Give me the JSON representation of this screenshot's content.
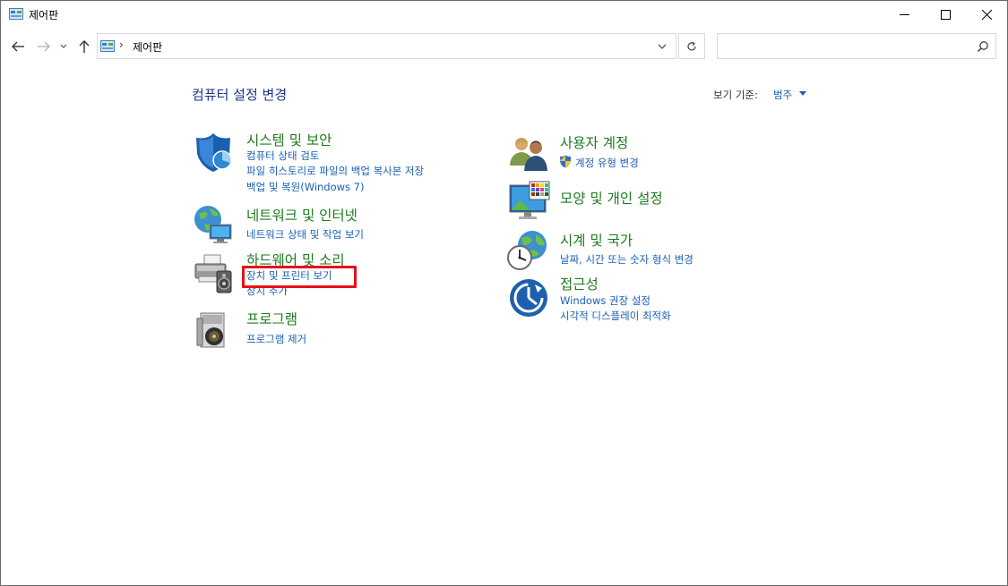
{
  "window": {
    "title": "제어판"
  },
  "nav": {
    "address": "제어판",
    "separator": "›",
    "search_placeholder": ""
  },
  "page": {
    "title": "컴퓨터 설정 변경",
    "view_by_label": "보기 기준:",
    "view_by_value": "범주"
  },
  "left": [
    {
      "title": "시스템 및 보안",
      "links": [
        "컴퓨터 상태 검토",
        "파일 히스토리로 파일의 백업 복사본 저장",
        "백업 및 복원(Windows 7)"
      ]
    },
    {
      "title": "네트워크 및 인터넷",
      "links": [
        "네트워크 상태 및 작업 보기"
      ]
    },
    {
      "title": "하드웨어 및 소리",
      "links": [
        "장치 및 프린터 보기",
        "장치 추가"
      ]
    },
    {
      "title": "프로그램",
      "links": [
        "프로그램 제거"
      ]
    }
  ],
  "right": [
    {
      "title": "사용자 계정",
      "links": [
        "계정 유형 변경"
      ]
    },
    {
      "title": "모양 및 개인 설정",
      "links": []
    },
    {
      "title": "시계 및 국가",
      "links": [
        "날짜, 시간 또는 숫자 형식 변경"
      ]
    },
    {
      "title": "접근성",
      "links": [
        "Windows 권장 설정",
        "시각적 디스플레이 최적화"
      ]
    }
  ],
  "colors": {
    "title_blue": "#1e3287",
    "category_green": "#1e7a1e",
    "link_blue": "#1a5fb4",
    "highlight_red": "#e8101a"
  },
  "icons": {
    "title": "control-panel-icon",
    "back": "arrow-left-icon",
    "forward": "arrow-right-icon",
    "recent": "chevron-down-icon",
    "up": "arrow-up-icon",
    "refresh": "refresh-icon",
    "search": "search-icon"
  }
}
